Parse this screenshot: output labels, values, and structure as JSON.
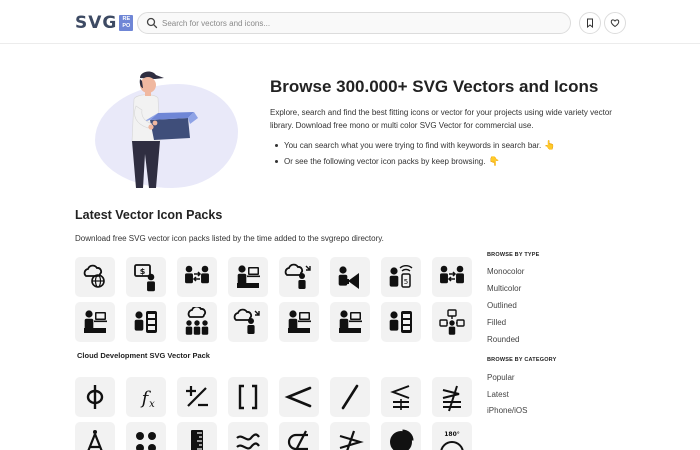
{
  "header": {
    "logo_text": "SVG",
    "logo_badge": "RE PO",
    "search_placeholder": "Search for vectors and icons..."
  },
  "hero": {
    "title": "Browse 300.000+ SVG Vectors and Icons",
    "description": "Explore, search and find the best fitting icons or vector for your projects using wide variety vector library. Download free mono or multi color SVG Vector for commercial use.",
    "bullets": [
      "You can search what you were trying to find with keywords in search bar.",
      "Or see the following vector icon packs by keep browsing."
    ],
    "hand_icons": [
      "👆",
      "👇"
    ]
  },
  "latest": {
    "title": "Latest Vector Icon Packs",
    "description": "Download free SVG vector icon packs listed by the time added to the svgrepo directory."
  },
  "packs": [
    {
      "name": "Cloud Development SVG Vector Pack",
      "icons": [
        "cloud-globe-icon",
        "money-screen-user-icon",
        "people-exchange-icon",
        "user-laptop-icon",
        "cloud-user-icon",
        "user-megaphone-icon",
        "user-wifi-device-icon",
        "people-exchange-icon",
        "user-laptop-icon",
        "user-server-icon",
        "cloud-team-icon",
        "cloud-user-icon",
        "user-laptop-icon",
        "user-laptop-icon",
        "user-server-icon",
        "network-user-icon"
      ]
    },
    {
      "name": "",
      "icons": [
        "phi-icon",
        "function-fx-icon",
        "plus-minus-icon",
        "brackets-icon",
        "less-than-icon",
        "slash-icon",
        "less-equal-icon",
        "not-equal-icon",
        "compass-icon",
        "four-dots-icon",
        "ruler-icon",
        "approx-icon",
        "not-subset-icon",
        "not-greater-icon",
        "pie-chart-icon",
        "protractor-icon"
      ]
    }
  ],
  "sidebar": {
    "type_heading": "BROWSE BY TYPE",
    "types": [
      "Monocolor",
      "Multicolor",
      "Outlined",
      "Filled",
      "Rounded"
    ],
    "category_heading": "BROWSE BY CATEGORY",
    "categories": [
      "Popular",
      "Latest",
      "iPhone/iOS"
    ]
  },
  "protractor_label": "180°"
}
